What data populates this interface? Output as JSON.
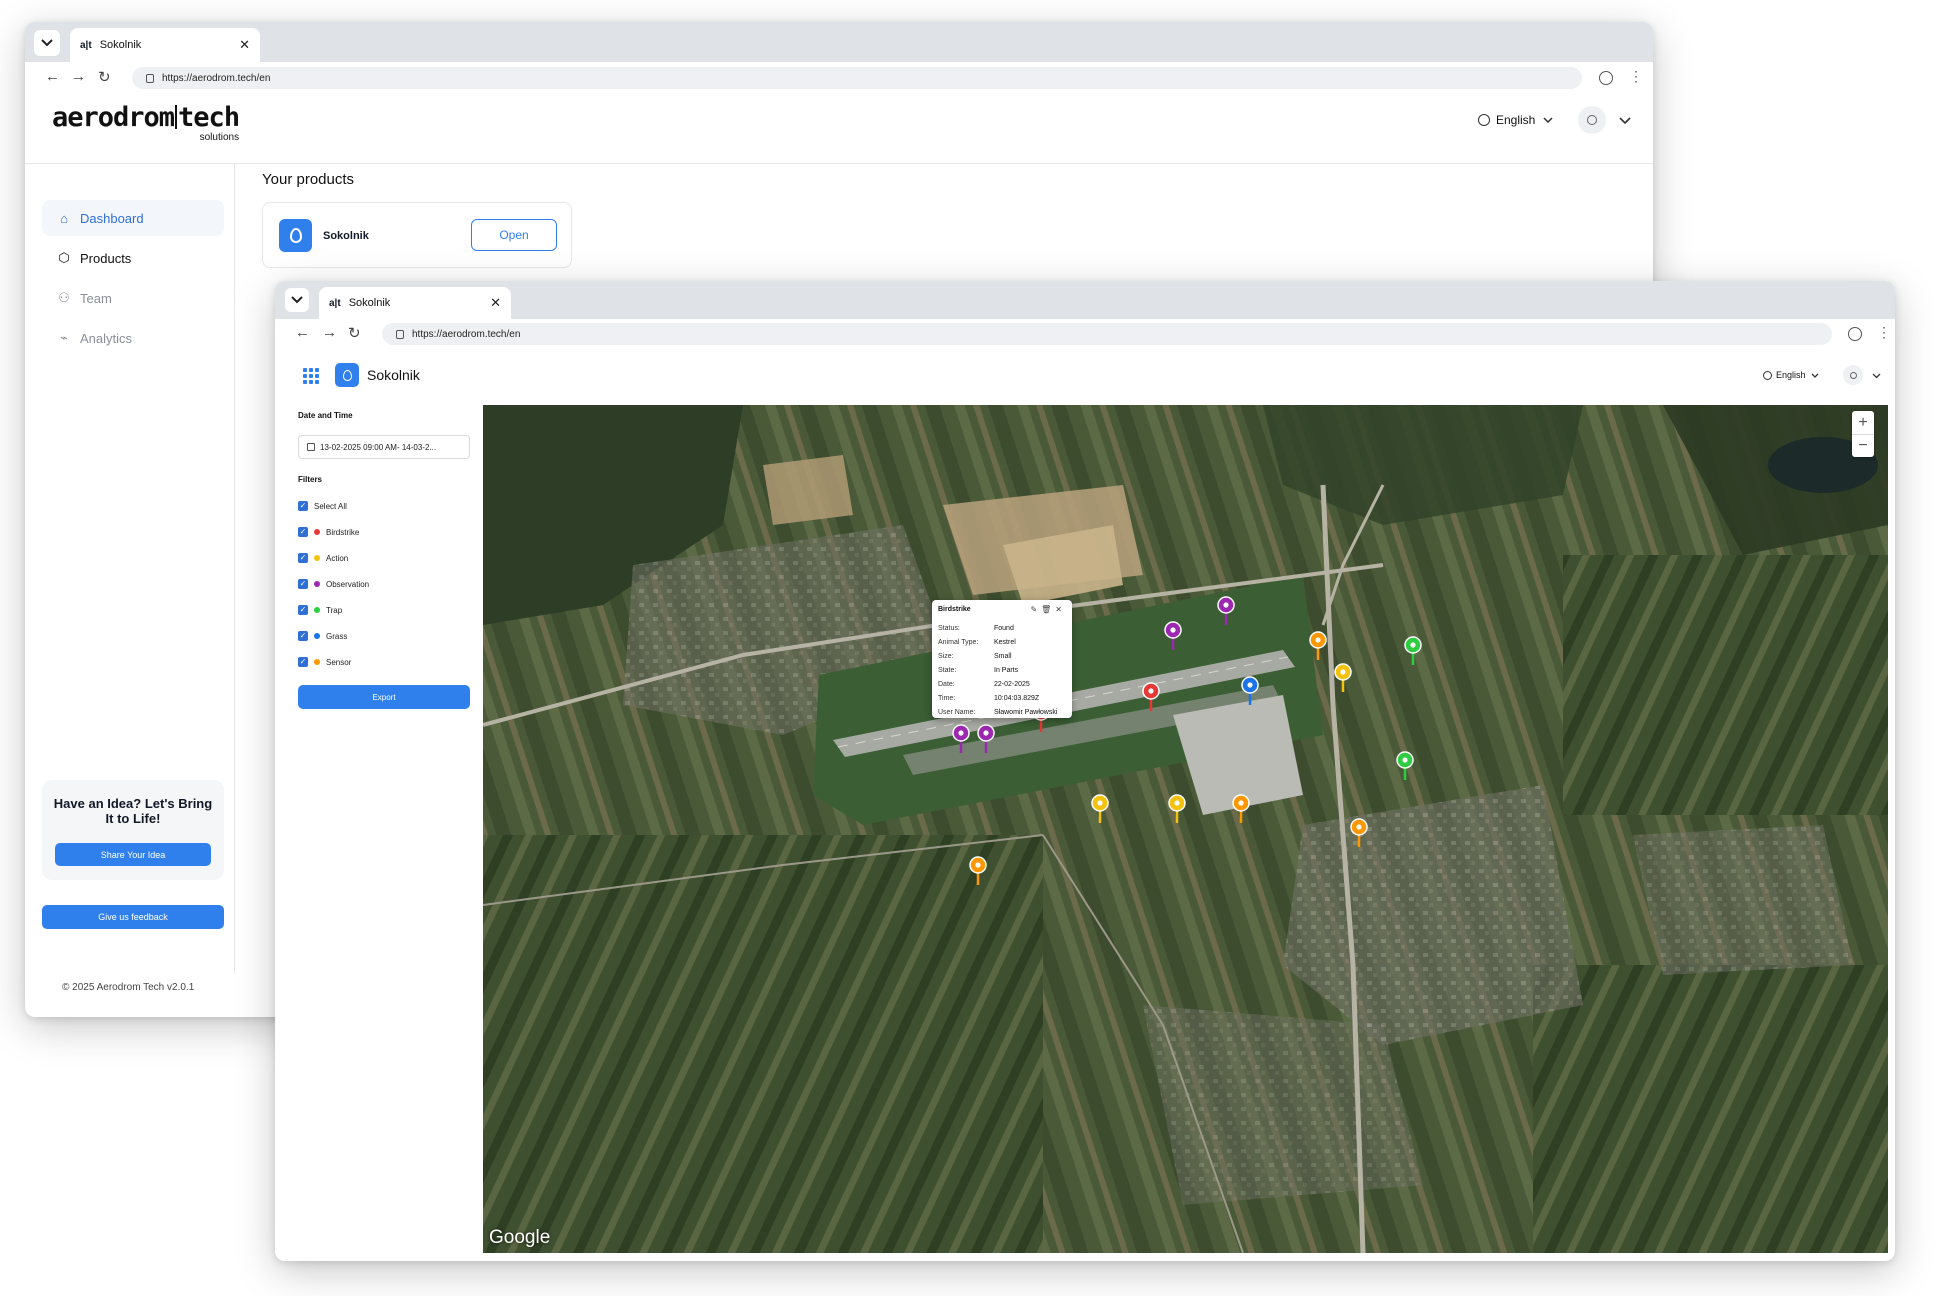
{
  "back_window": {
    "tab": {
      "favicon": "a|t",
      "title": "Sokolnik"
    },
    "url": "https://aerodrom.tech/en",
    "logo": {
      "main_left": "aerodrom",
      "main_right": "tech",
      "sub": "solutions"
    },
    "language": "English",
    "sidebar": {
      "items": [
        {
          "label": "Dashboard",
          "icon": "home-icon"
        },
        {
          "label": "Products",
          "icon": "cube-icon"
        },
        {
          "label": "Team",
          "icon": "team-icon"
        },
        {
          "label": "Analytics",
          "icon": "chart-icon"
        }
      ],
      "idea_card": {
        "heading": "Have an Idea? Let's Bring It to Life!",
        "button": "Share Your Idea"
      },
      "feedback_button": "Give us feedback",
      "copyright": "© 2025 Aerodrom Tech v2.0.1"
    },
    "main": {
      "title": "Your products",
      "product": {
        "name": "Sokolnik",
        "open_label": "Open"
      }
    }
  },
  "front_window": {
    "tab": {
      "favicon": "a|t",
      "title": "Sokolnik"
    },
    "url": "https://aerodrom.tech/en",
    "app_title": "Sokolnik",
    "language": "English",
    "panel": {
      "date_label": "Date and Time",
      "date_value": "13-02-2025 09:00 AM- 14-03-2...",
      "filters_label": "Filters",
      "filters": [
        {
          "label": "Select All",
          "color": ""
        },
        {
          "label": "Birdstrike",
          "color": "#e53935"
        },
        {
          "label": "Action",
          "color": "#f4c20d"
        },
        {
          "label": "Observation",
          "color": "#9c27b0"
        },
        {
          "label": "Trap",
          "color": "#2ecc40"
        },
        {
          "label": "Grass",
          "color": "#1a73e8"
        },
        {
          "label": "Sensor",
          "color": "#ff9800"
        }
      ],
      "export_label": "Export"
    },
    "map": {
      "attribution": "Google",
      "zoom_in": "+",
      "zoom_out": "−",
      "popup": {
        "title": "Birdstrike",
        "rows": [
          {
            "key": "Status:",
            "value": "Found"
          },
          {
            "key": "Animal Type:",
            "value": "Kestrel"
          },
          {
            "key": "Size:",
            "value": "Small"
          },
          {
            "key": "State:",
            "value": "In Parts"
          },
          {
            "key": "Date:",
            "value": "22-02-2025"
          },
          {
            "key": "Time:",
            "value": "10:04:03.829Z"
          },
          {
            "key": "User Name:",
            "value": "Sławomir Pawłowski"
          }
        ]
      }
    }
  },
  "colors": {
    "accent": "#2f80ed",
    "birdstrike": "#e53935",
    "action": "#f4c20d",
    "observation": "#9c27b0",
    "trap": "#2ecc40",
    "grass": "#1a73e8",
    "sensor": "#ff9800"
  }
}
